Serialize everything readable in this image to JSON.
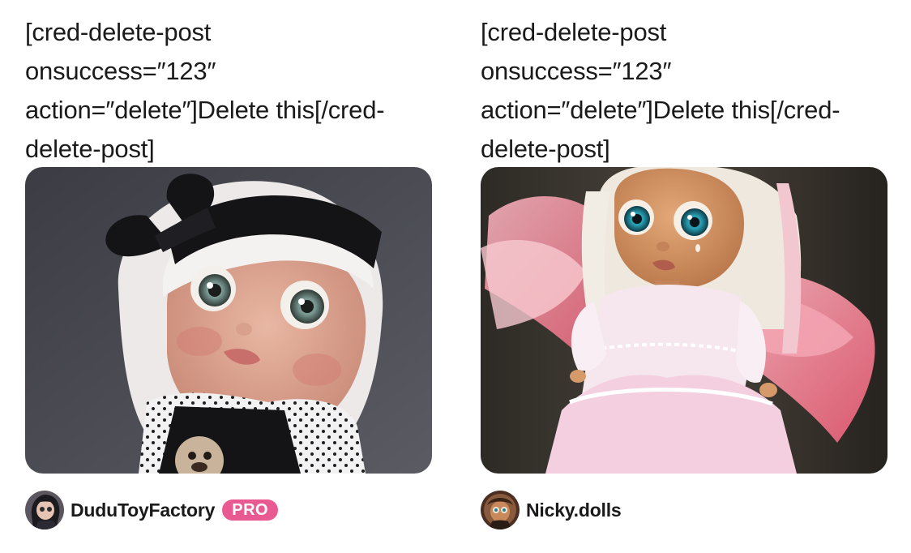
{
  "posts": [
    {
      "caption_lines": [
        "[cred-delete-post",
        "onsuccess=″123″",
        "action=″delete″]Delete this[/cred-",
        "delete-post]"
      ],
      "image_alt": "Blythe doll with white bob hair and black headband",
      "author": {
        "name": "DuduToyFactory",
        "badge": "PRO"
      }
    },
    {
      "caption_lines": [
        "[cred-delete-post",
        "onsuccess=″123″",
        "action=″delete″]Delete this[/cred-",
        "delete-post]"
      ],
      "image_alt": "Blythe doll with pink feather wings and white dress",
      "author": {
        "name": "Nicky.dolls",
        "badge": ""
      }
    }
  ],
  "colors": {
    "badge": "#ea5a92",
    "text": "#1a1a1a"
  }
}
